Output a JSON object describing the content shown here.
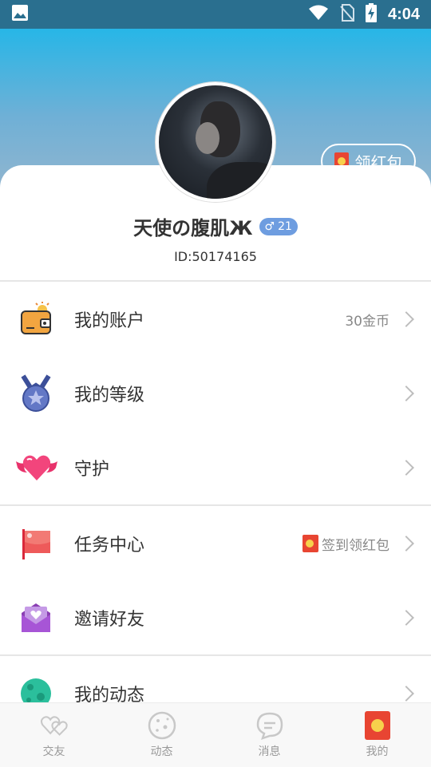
{
  "status_bar": {
    "time": "4:04"
  },
  "header": {
    "red_packet_label": "领红包"
  },
  "profile": {
    "name": "天使の腹肌Ж",
    "gender_symbol": "♂",
    "age": "21",
    "id_text": "ID:50174165"
  },
  "menu": [
    {
      "label": "我的账户",
      "right_text": "30金币",
      "icon": "wallet-icon"
    },
    {
      "label": "我的等级",
      "right_text": "",
      "icon": "medal-icon"
    },
    {
      "label": "守护",
      "right_text": "",
      "icon": "winged-heart-icon"
    },
    {
      "label": "任务中心",
      "right_text": "签到领红包",
      "icon": "flag-icon"
    },
    {
      "label": "邀请好友",
      "right_text": "",
      "icon": "envelope-heart-icon"
    },
    {
      "label": "我的动态",
      "right_text": "",
      "icon": "planet-icon"
    }
  ],
  "bottom_nav": [
    {
      "label": "交友",
      "icon": "hearts-icon",
      "active": false
    },
    {
      "label": "动态",
      "icon": "cookie-icon",
      "active": false
    },
    {
      "label": "消息",
      "icon": "chat-icon",
      "active": false
    },
    {
      "label": "我的",
      "icon": "red-packet-icon",
      "active": true
    }
  ],
  "colors": {
    "status_bar": "#2a6f8f",
    "header_top": "#27b6e7",
    "header_bottom": "#90b5cf",
    "gender_badge": "#6e9de0",
    "red_packet": "#e84532"
  }
}
